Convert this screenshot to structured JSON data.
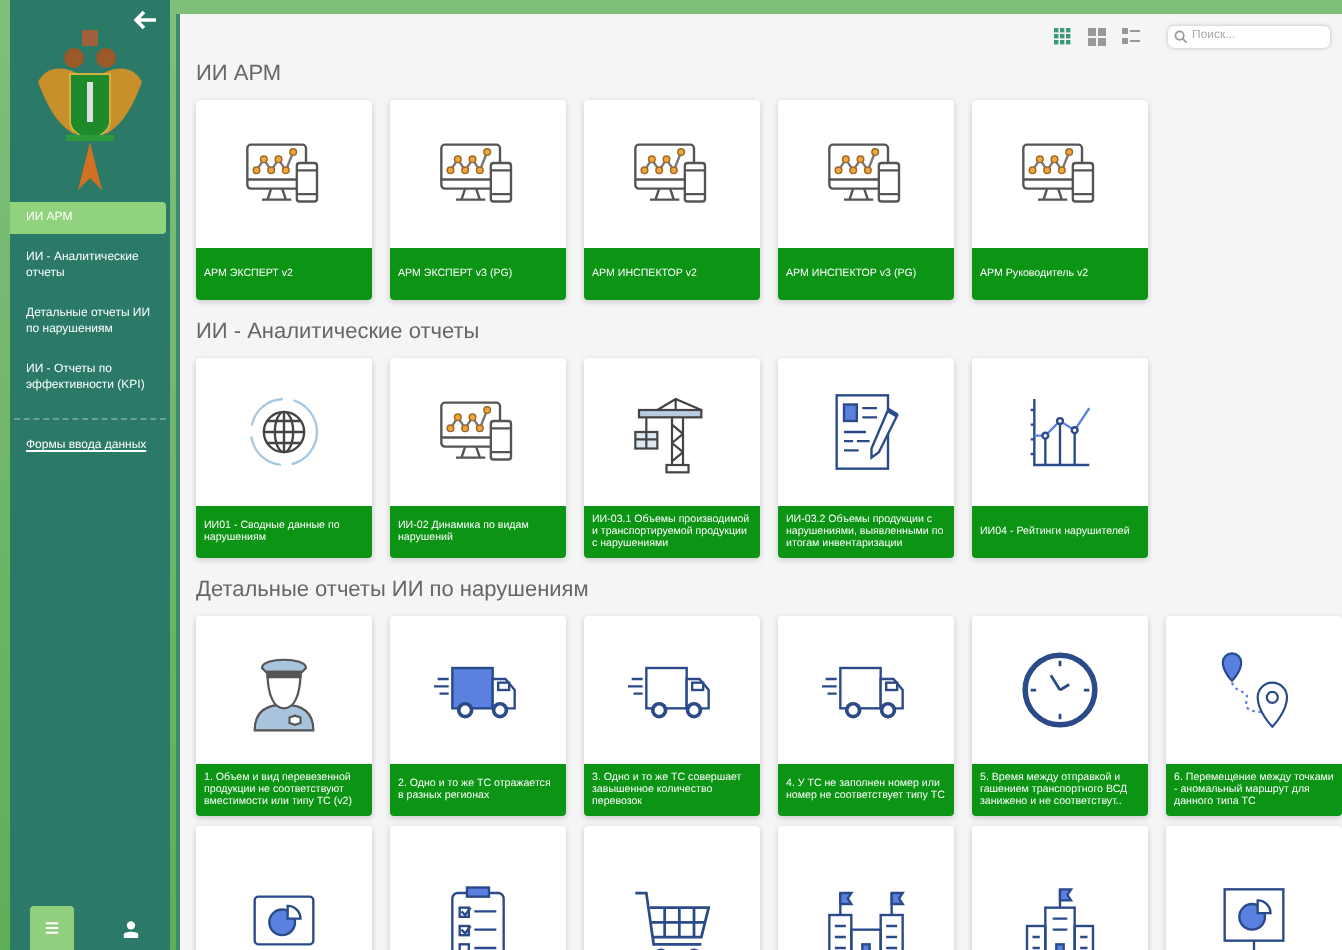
{
  "sidebar": {
    "items": [
      {
        "label": "ИИ АРМ",
        "selected": true
      },
      {
        "label": "ИИ - Аналитические отчеты",
        "selected": false
      },
      {
        "label": "Детальные отчеты ИИ по нарушениям",
        "selected": false
      },
      {
        "label": "ИИ - Отчеты по эффективности (KPI)",
        "selected": false
      }
    ],
    "link": "Формы ввода данных"
  },
  "toolbar": {
    "views": [
      {
        "kind": "grid",
        "selected": true
      },
      {
        "kind": "tiles",
        "selected": false
      },
      {
        "kind": "list",
        "selected": false
      }
    ],
    "search": {
      "placeholder": "Поиск..."
    }
  },
  "sections": [
    {
      "title": "ИИ АРМ",
      "cards": [
        {
          "kind": "monitor",
          "caption": "АРМ ЭКСПЕРТ v2"
        },
        {
          "kind": "monitor",
          "caption": "АРМ ЭКСПЕРТ v3 (PG)"
        },
        {
          "kind": "monitor",
          "caption": "АРМ ИНСПЕКТОР v2"
        },
        {
          "kind": "monitor",
          "caption": "АРМ ИНСПЕКТОР v3 (PG)"
        },
        {
          "kind": "monitor",
          "caption": "АРМ Руководитель v2"
        }
      ]
    },
    {
      "title": "ИИ - Аналитические отчеты",
      "cards": [
        {
          "kind": "globe",
          "caption": "ИИ01 - Сводные данные по нарушениям"
        },
        {
          "kind": "monitor",
          "caption": "ИИ-02 Динамика по видам нарушений"
        },
        {
          "kind": "crane",
          "caption": "ИИ-03.1 Объемы производимой и транспортируемой продукции с нарушениями"
        },
        {
          "kind": "document",
          "caption": "ИИ-03.2 Объемы продукции с нарушениями, выявленными по итогам инвентаризации"
        },
        {
          "kind": "linechart",
          "caption": "ИИ04 - Рейтинги нарушителей"
        }
      ]
    },
    {
      "title": "Детальные отчеты ИИ по нарушениям",
      "cards": [
        {
          "kind": "officer",
          "caption": "1. Объем и вид перевезенной продукции не соответствуют вместимости или типу ТС (v2)"
        },
        {
          "kind": "truckfilled",
          "caption": "2. Одно и то же ТС отражается в разных регионах"
        },
        {
          "kind": "truck",
          "caption": "3. Одно и то же ТС совершает завышенное количество перевозок"
        },
        {
          "kind": "truck",
          "caption": "4. У ТС не заполнен номер или номер не соответствует типу ТС"
        },
        {
          "kind": "clock",
          "caption": "5. Время между отправкой и гашением транспортного ВСД занижено и не соответствут.."
        },
        {
          "kind": "route",
          "caption": "6. Перемещение между точками - аномальный маршрут для данного типа ТС"
        },
        {
          "kind": "laptop"
        },
        {
          "kind": "checklist"
        },
        {
          "kind": "cart"
        },
        {
          "kind": "buildingflags"
        },
        {
          "kind": "building"
        },
        {
          "kind": "board"
        }
      ]
    }
  ]
}
